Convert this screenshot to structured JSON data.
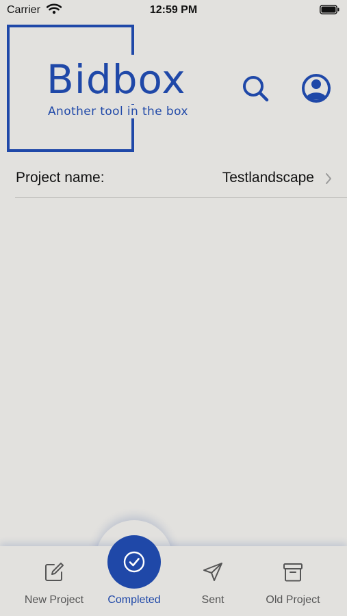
{
  "status_bar": {
    "carrier": "Carrier",
    "time": "12:59 PM"
  },
  "header": {
    "logo_title": "Bidbox",
    "logo_tagline": "Another tool in the box"
  },
  "project": {
    "label": "Project name:",
    "value": "Testlandscape"
  },
  "tabs": [
    {
      "label": "New Project",
      "icon": "edit-icon"
    },
    {
      "label": "Completed",
      "icon": "check-circle-icon",
      "active": true
    },
    {
      "label": "Sent",
      "icon": "send-icon"
    },
    {
      "label": "Old Project",
      "icon": "archive-icon"
    }
  ],
  "colors": {
    "accent": "#1f48a8",
    "background": "#e2e1de"
  }
}
